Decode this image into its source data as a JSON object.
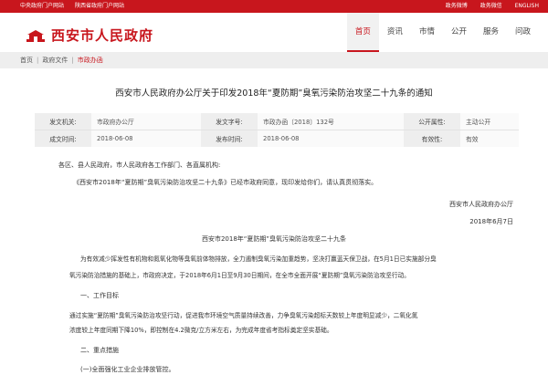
{
  "topbar": {
    "left": [
      "中央政府门户网站",
      "陕西省政府门户网站"
    ],
    "right": [
      "政务微博",
      "政务微信",
      "ENGLISH"
    ]
  },
  "header": {
    "logo_text": "西安市人民政府",
    "nav": [
      "首页",
      "资讯",
      "市情",
      "公开",
      "服务",
      "问政"
    ]
  },
  "breadcrumb": [
    "首页",
    "政府文件",
    "市政办函"
  ],
  "article": {
    "title": "西安市人民政府办公厅关于印发2018年“夏防期”臭氧污染防治攻坚二十九条的通知",
    "meta": {
      "row1": [
        {
          "label": "发文机关:",
          "value": "市政府办公厅"
        },
        {
          "label": "发文字号:",
          "value": "市政办函〔2018〕132号"
        },
        {
          "label": "公开属性:",
          "value": "主动公开"
        }
      ],
      "row2": [
        {
          "label": "成文时间:",
          "value": "2018-06-08"
        },
        {
          "label": "发布时间:",
          "value": "2018-06-08"
        },
        {
          "label": "有效性:",
          "value": "有效"
        }
      ]
    },
    "greeting": "各区、县人民政府，市人民政府各工作部门、各直属机构:",
    "intro": "《西安市2018年“夏防期”臭氧污染防治攻坚二十九条》已经市政府同意，现印发给你们，请认真贯彻落实。",
    "signature": "西安市人民政府办公厅",
    "date": "2018年6月7日",
    "subtitle": "西安市2018年“夏防期”臭氧污染防治攻坚二十九条",
    "p1_line1": "为有效减少挥发性有机物和氮氧化物等臭氧前体物排放，全力遏制臭氧污染加重趋势，坚决打赢蓝天保卫战，在5月1日已实施部分臭",
    "p1_line2": "氧污染防治措施的基础上，市政府决定，于2018年6月1日至9月30日期间，在全市全面开展“夏防期”臭氧污染防治攻坚行动。",
    "h1": "一、工作目标",
    "p2_line1": "通过实施“夏防期”臭氧污染防治攻坚行动，促进我市环境空气质量持续改善，力争臭氧污染超标天数较上年度明显减少，二氧化氮",
    "p2_line2": "浓度较上年度同期下降10%，即控制在4.2微克/立方米左右，为完成年度省考指标奠定坚实基础。",
    "h2": "二、重点措施",
    "h3": "(一)全面强化工业企业排放管控。"
  }
}
